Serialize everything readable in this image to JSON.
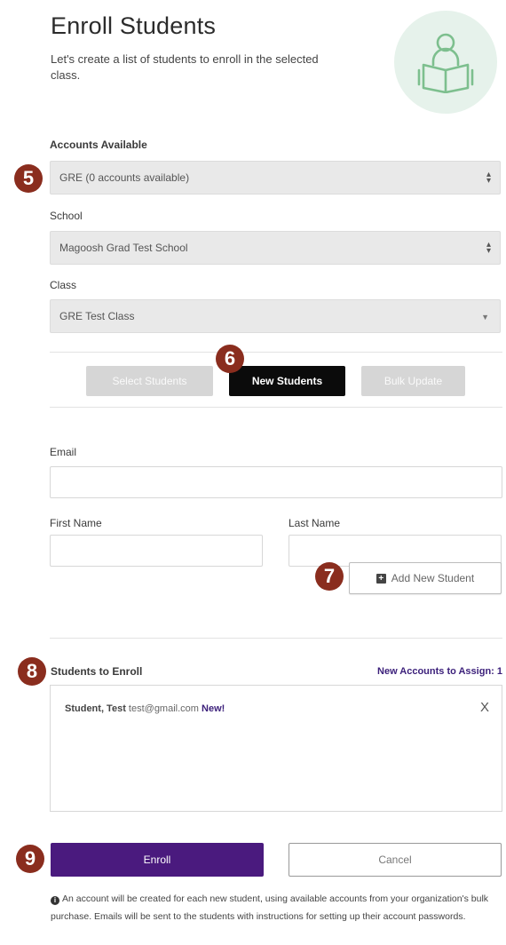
{
  "header": {
    "title": "Enroll Students",
    "subtitle": "Let's create a list of students to enroll in the selected class."
  },
  "accounts": {
    "label": "Accounts Available",
    "selected": "GRE (0 accounts available)"
  },
  "school": {
    "label": "School",
    "selected": "Magoosh Grad Test School"
  },
  "class_field": {
    "label": "Class",
    "selected": "GRE Test Class"
  },
  "tabs": [
    {
      "label": "Select Students",
      "active": false
    },
    {
      "label": "New Students",
      "active": true
    },
    {
      "label": "Bulk Update",
      "active": false
    }
  ],
  "form": {
    "email_label": "Email",
    "email_value": "",
    "first_name_label": "First Name",
    "first_name_value": "",
    "last_name_label": "Last Name",
    "last_name_value": "",
    "add_button": "Add New Student"
  },
  "enroll_list": {
    "label": "Students to Enroll",
    "assign_text": "New Accounts to Assign: 1",
    "students": [
      {
        "name": "Student, Test",
        "email": "test@gmail.com",
        "tag": "New!"
      }
    ],
    "remove_glyph": "X"
  },
  "actions": {
    "enroll": "Enroll",
    "cancel": "Cancel"
  },
  "note": "An account will be created for each new student, using available accounts from your organization's bulk purchase. Emails will be sent to the students with instructions for setting up their account passwords.",
  "badges": [
    "5",
    "6",
    "7",
    "8",
    "9"
  ],
  "colors": {
    "brand_purple": "#4a1a7e",
    "badge_red": "#8a2d1e",
    "icon_green": "#7dbf8e",
    "icon_bg": "#e6f2eb"
  }
}
